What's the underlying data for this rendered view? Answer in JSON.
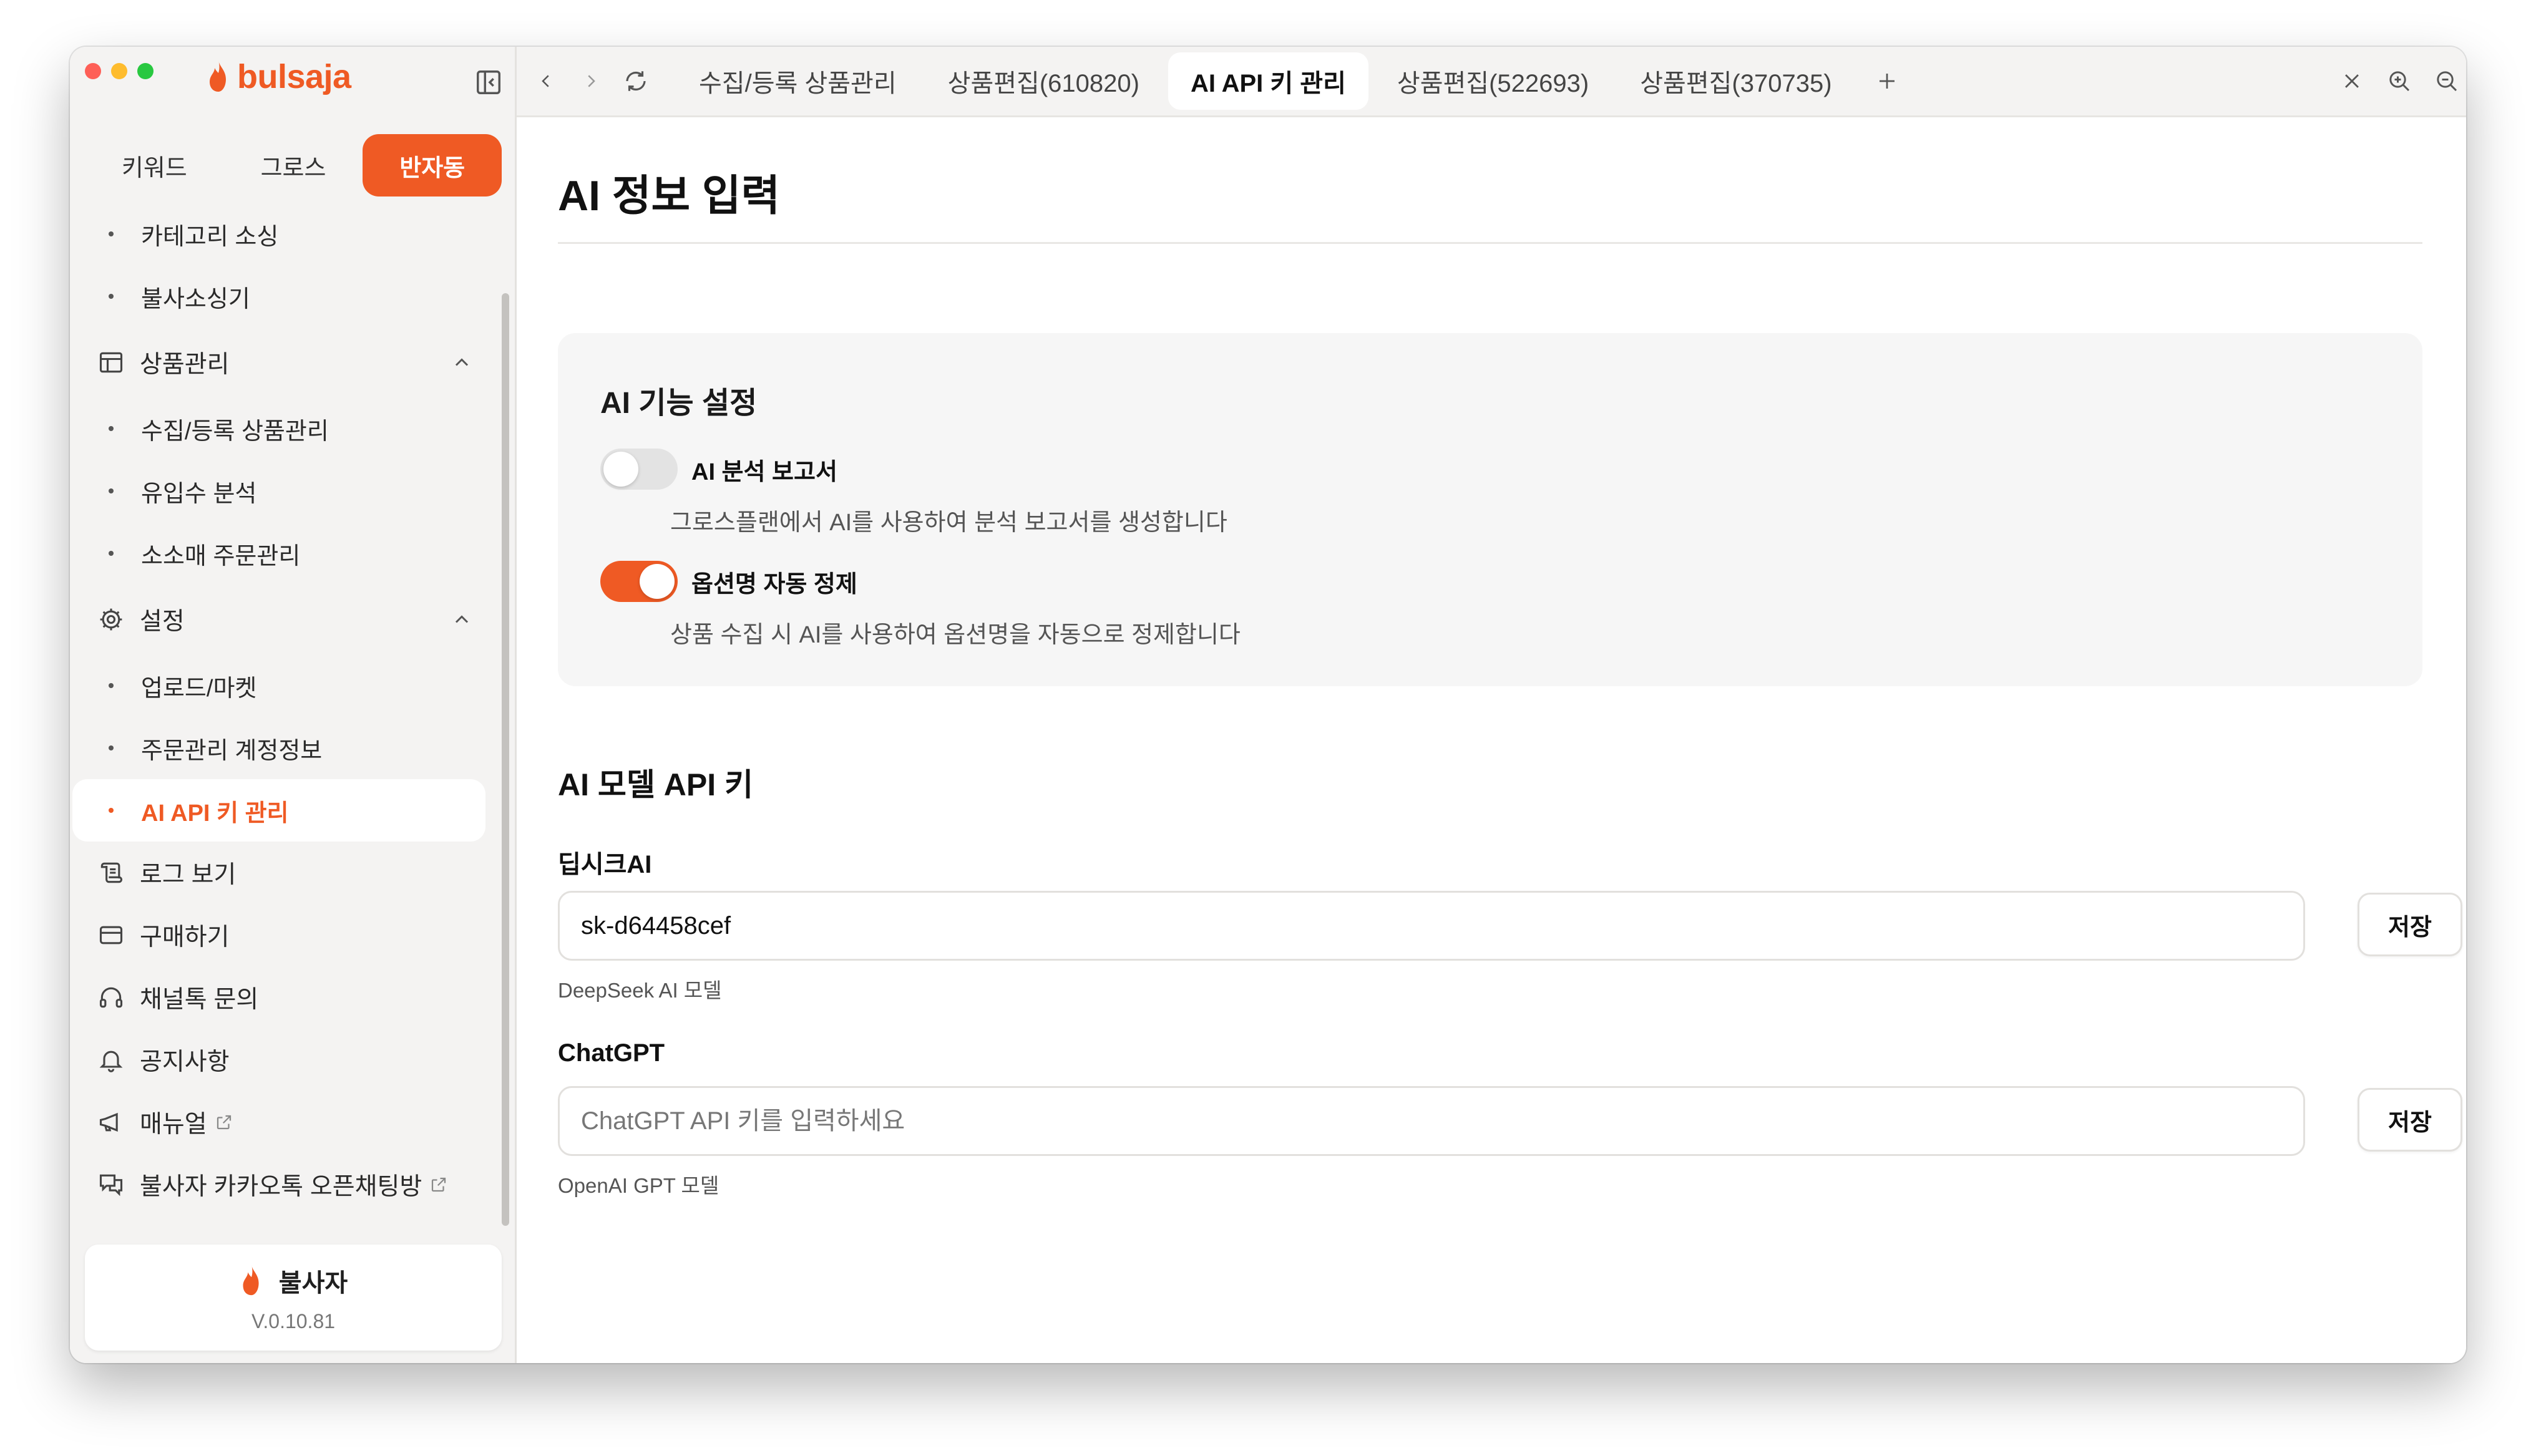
{
  "app": {
    "brand": "bulsaja",
    "accent": "#ef5a24"
  },
  "sidebar": {
    "mode_tabs": [
      {
        "label": "키워드",
        "active": false
      },
      {
        "label": "그로스",
        "active": false
      },
      {
        "label": "반자동",
        "active": true
      }
    ],
    "items": [
      {
        "type": "sub",
        "label": "카테고리 소싱"
      },
      {
        "type": "sub",
        "label": "불사소싱기"
      },
      {
        "type": "group",
        "label": "상품관리",
        "icon": "table-icon",
        "expanded": true
      },
      {
        "type": "sub",
        "label": "수집/등록 상품관리"
      },
      {
        "type": "sub",
        "label": "유입수 분석"
      },
      {
        "type": "sub",
        "label": "소소매 주문관리"
      },
      {
        "type": "group",
        "label": "설정",
        "icon": "gear-icon",
        "expanded": true
      },
      {
        "type": "sub",
        "label": "업로드/마켓"
      },
      {
        "type": "sub",
        "label": "주문관리 계정정보"
      },
      {
        "type": "sub",
        "label": "AI API 키 관리",
        "active": true
      },
      {
        "type": "item",
        "label": "로그 보기",
        "icon": "scroll-icon"
      },
      {
        "type": "item",
        "label": "구매하기",
        "icon": "credit-card-icon"
      },
      {
        "type": "item",
        "label": "채널톡 문의",
        "icon": "headset-icon"
      },
      {
        "type": "item",
        "label": "공지사항",
        "icon": "bell-icon"
      },
      {
        "type": "item",
        "label": "매뉴얼",
        "icon": "megaphone-icon",
        "external": true
      },
      {
        "type": "item",
        "label": "불사자 카카오톡 오픈채팅방",
        "icon": "chat-icon",
        "external": true
      }
    ],
    "footer": {
      "name": "불사자",
      "version": "V.0.10.81"
    }
  },
  "topbar": {
    "tabs": [
      {
        "label": "수집/등록 상품관리",
        "active": false
      },
      {
        "label": "상품편집(610820)",
        "active": false
      },
      {
        "label": "AI API 키 관리",
        "active": true
      },
      {
        "label": "상품편집(522693)",
        "active": false
      },
      {
        "label": "상품편집(370735)",
        "active": false
      }
    ]
  },
  "main": {
    "page_title": "AI 정보 입력",
    "ai_settings": {
      "title": "AI 기능 설정",
      "toggles": [
        {
          "label": "AI 분석 보고서",
          "description": "그로스플랜에서 AI를 사용하여 분석 보고서를 생성합니다",
          "enabled": false
        },
        {
          "label": "옵션명 자동 정제",
          "description": "상품 수집 시 AI를 사용하여 옵션명을 자동으로 정제합니다",
          "enabled": true
        }
      ]
    },
    "api_keys": {
      "title": "AI 모델 API 키",
      "fields": [
        {
          "label": "딥시크AI",
          "value": "sk-d64458cef",
          "placeholder": "",
          "help": "DeepSeek AI 모델",
          "save_label": "저장"
        },
        {
          "label": "ChatGPT",
          "value": "",
          "placeholder": "ChatGPT API 키를 입력하세요",
          "help": "OpenAI GPT 모델",
          "save_label": "저장"
        }
      ]
    }
  }
}
